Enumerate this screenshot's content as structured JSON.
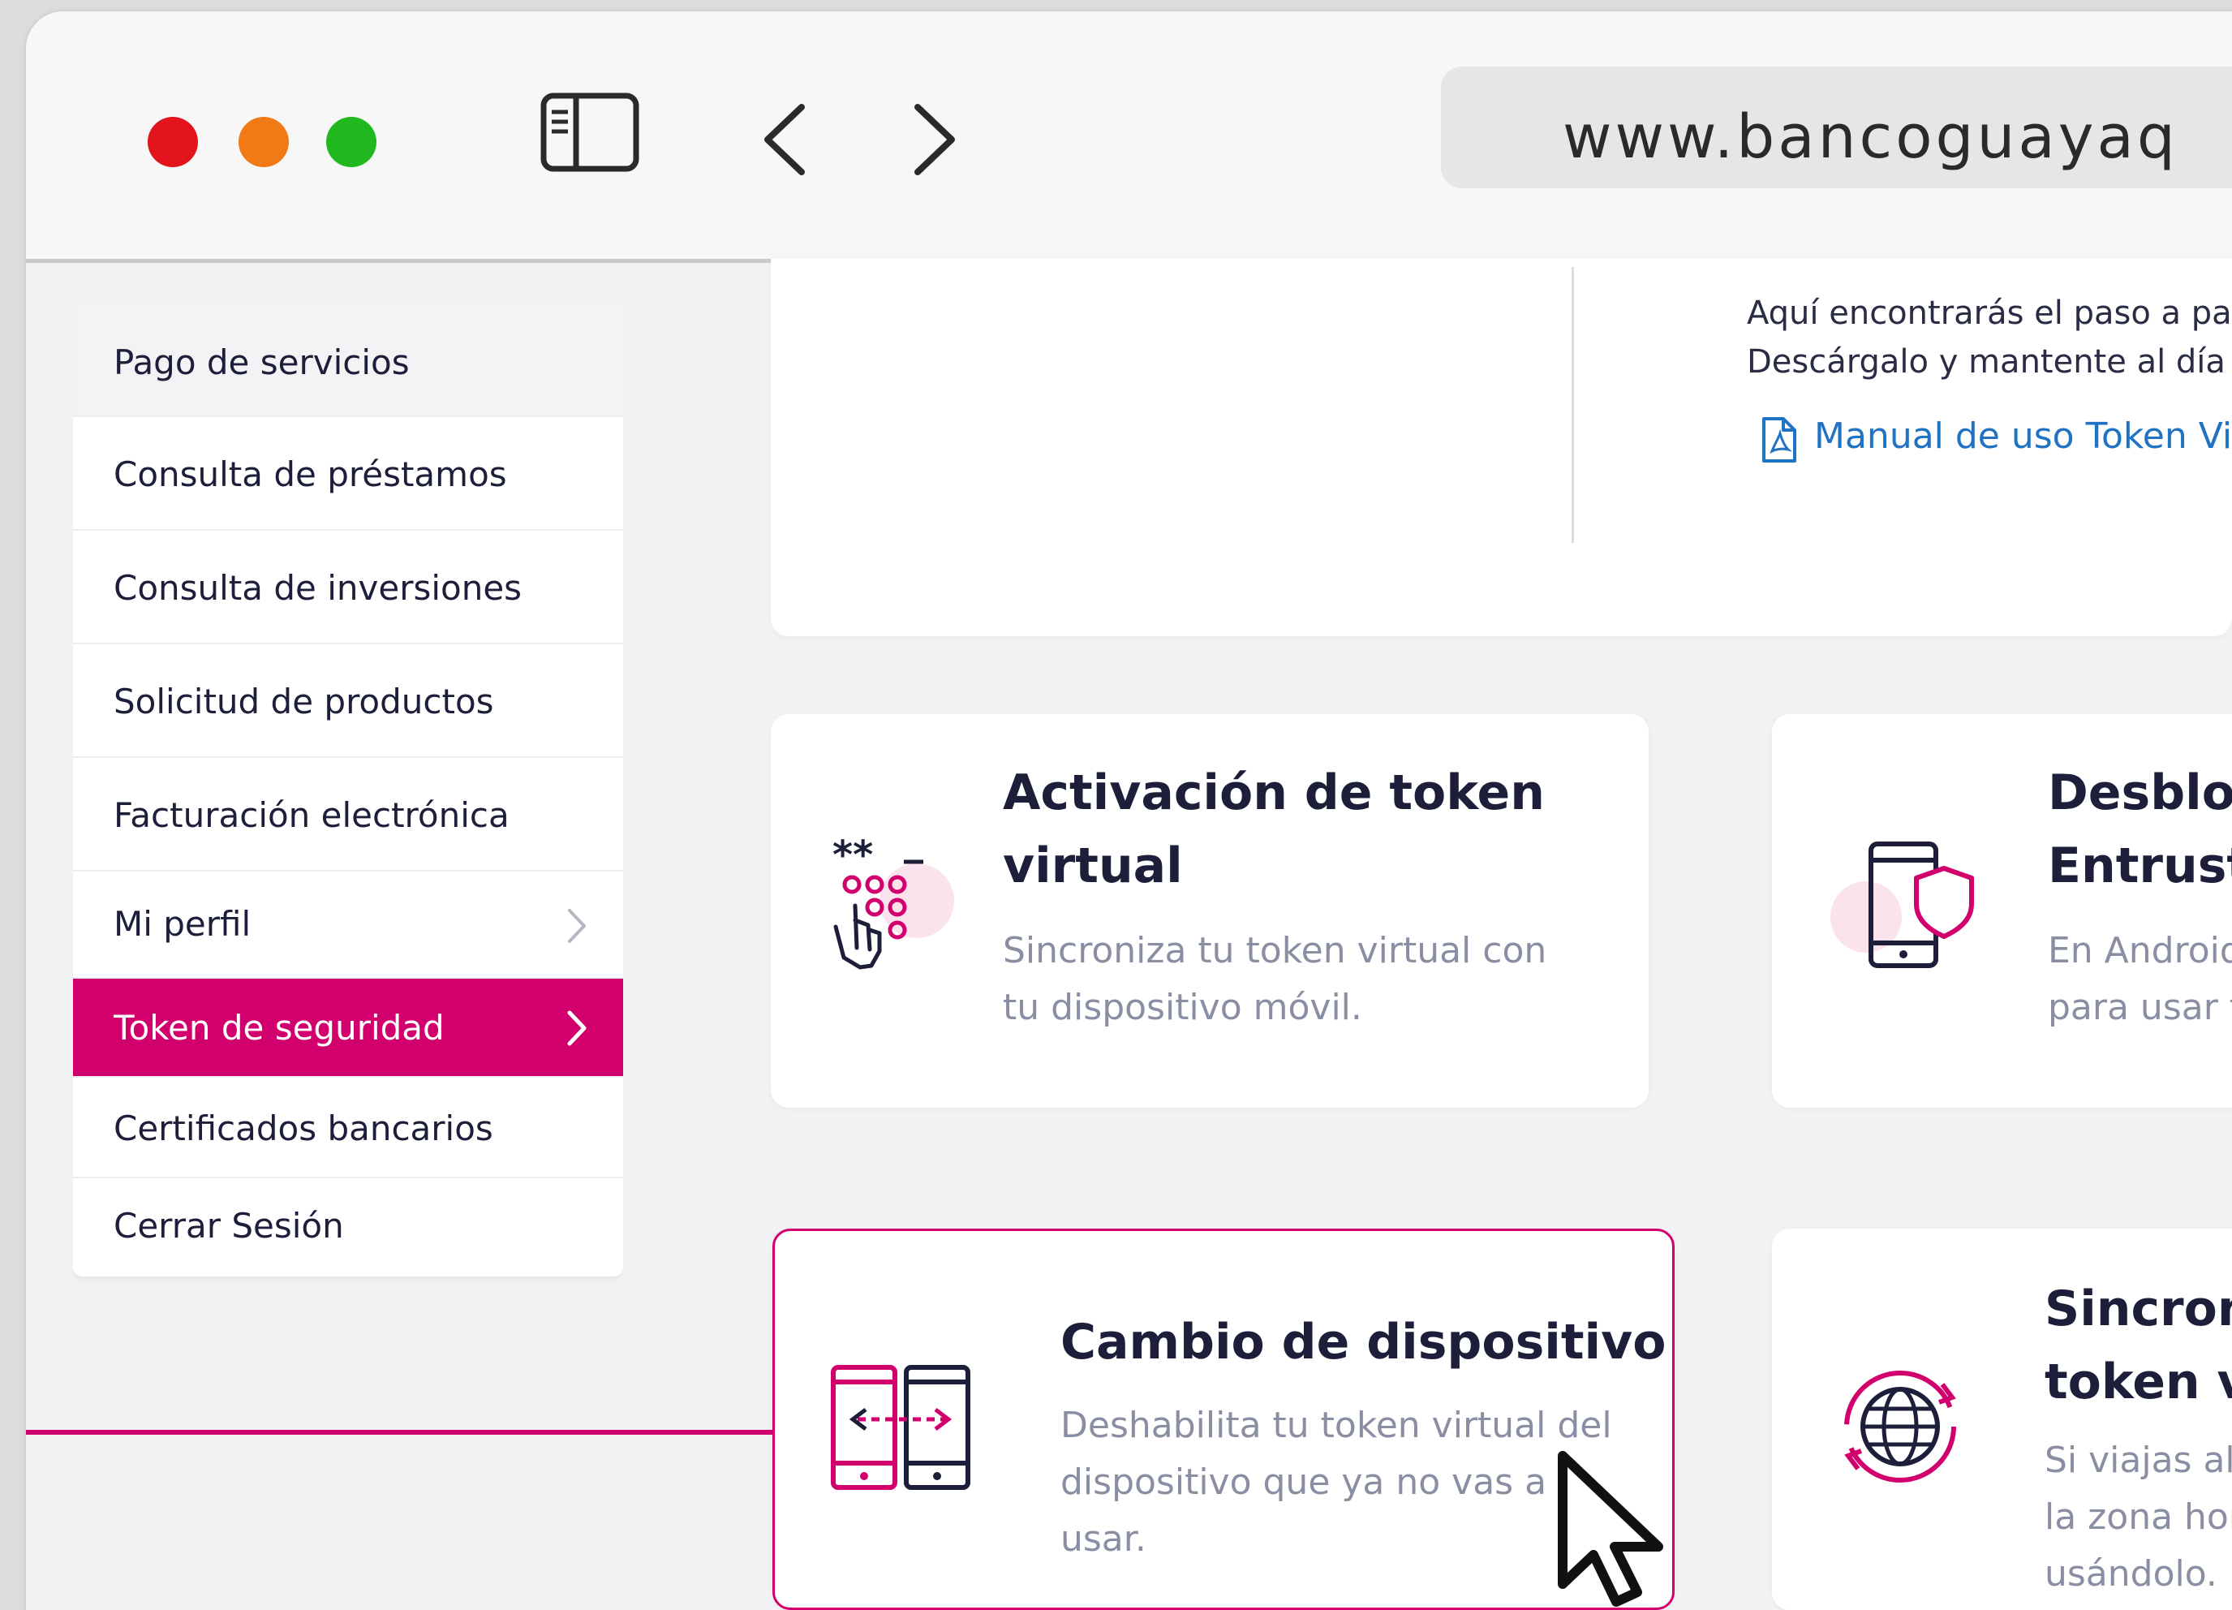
{
  "browser": {
    "url": "www.bancoguayaq"
  },
  "sidebar": {
    "items": [
      {
        "label": "Pago de servicios"
      },
      {
        "label": "Consulta de préstamos"
      },
      {
        "label": "Consulta de inversiones"
      },
      {
        "label": "Solicitud de productos"
      },
      {
        "label": "Facturación electrónica"
      },
      {
        "label": "Mi perfil"
      },
      {
        "label": "Token de seguridad",
        "active": true
      },
      {
        "label": "Certificados bancarios"
      },
      {
        "label": "Cerrar Sesión"
      }
    ]
  },
  "manual": {
    "line1": "Aquí encontrarás el paso a pas",
    "line2": "Descárgalo y mantente al día c",
    "link": "Manual de uso Token Vi"
  },
  "cards": [
    {
      "title_l1": "Activación de token",
      "title_l2": "virtual",
      "desc_l1": "Sincroniza tu token virtual con",
      "desc_l2": "tu dispositivo móvil."
    },
    {
      "title_l1": "Desbloqu",
      "title_l2": "Entrust t",
      "desc_l1": "En Android,",
      "desc_l2": "para usar tu"
    },
    {
      "title_l1": "Cambio de dispositivo",
      "desc_l1": "Deshabilita tu token virtual del",
      "desc_l2": "dispositivo que ya no vas a",
      "desc_l3": "usar."
    },
    {
      "title_l1": "Sincroniz",
      "title_l2": "token vir",
      "desc_l1": "Si viajas al e",
      "desc_l2": "la zona hora",
      "desc_l3": "usándolo."
    }
  ],
  "colors": {
    "accent": "#d2006c",
    "text": "#1d1f3a",
    "muted": "#8a8ea3",
    "link": "#1f72c4"
  }
}
